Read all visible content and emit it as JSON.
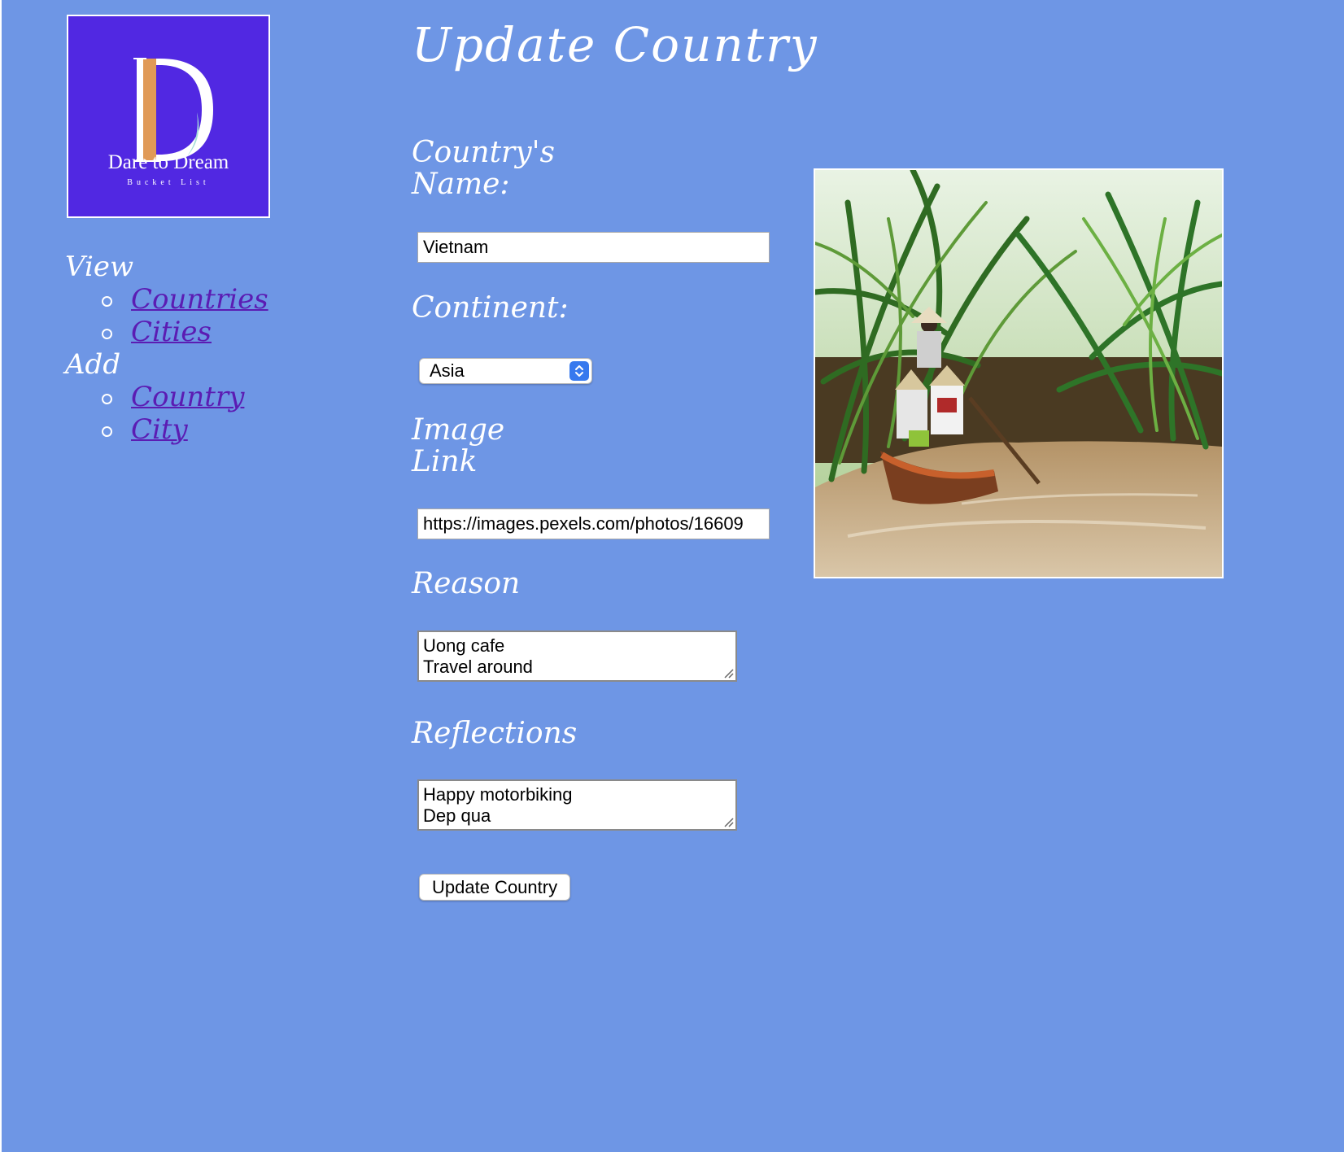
{
  "logo": {
    "brand": "Dare to Dream",
    "tagline": "Bucket List",
    "background": "#5128e2"
  },
  "nav": {
    "view_heading": "View",
    "view_items": [
      "Countries",
      "Cities"
    ],
    "add_heading": "Add",
    "add_items": [
      "Country",
      "City"
    ]
  },
  "page": {
    "title": "Update Country",
    "background": "#6e96e5"
  },
  "form": {
    "name_label_line1": "Country's",
    "name_label_line2": "Name:",
    "name_value": "Vietnam",
    "continent_label": "Continent:",
    "continent_value": "Asia",
    "image_label_line1": "Image",
    "image_label_line2": "Link",
    "image_value": "https://images.pexels.com/photos/16609",
    "reason_label": "Reason",
    "reason_lines": [
      "Uong cafe",
      "Travel around"
    ],
    "reflections_label": "Reflections",
    "reflections_lines": [
      "Happy motorbiking",
      "Dep qua"
    ],
    "submit_label": "Update Country"
  },
  "icons": {
    "select_arrows": "chevron-up-down-icon",
    "resize_grip": "resize-grip-icon"
  }
}
